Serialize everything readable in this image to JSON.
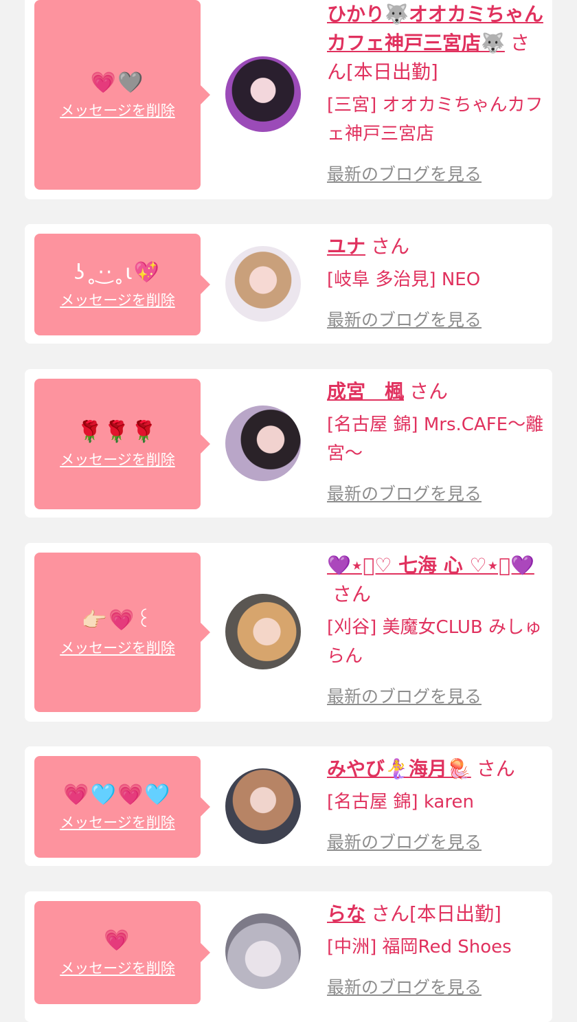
{
  "items": [
    {
      "emoji": "💗🩶",
      "delete_label": "メッセージを削除",
      "name": "ひかり🐺オオカミちゃんカフェ神戸三宮店🐺",
      "suffix": "さん[本日出勤]",
      "shop": "[三宮] オオカミちゃんカフェ神戸三宮店",
      "blog_label": "最新のブログを見る"
    },
    {
      "emoji": "ʖ˳·͜·˳ɩ💖",
      "delete_label": "メッセージを削除",
      "name": "ユナ",
      "suffix": "さん",
      "shop": "[岐阜 多治見] NEO",
      "blog_label": "最新のブログを見る"
    },
    {
      "emoji": "🌹🌹🌹",
      "delete_label": "メッセージを削除",
      "name": "成宮　楓",
      "suffix": "さん",
      "shop": "[名古屋 錦] Mrs.CAFE〜離宮〜",
      "blog_label": "最新のブログを見る"
    },
    {
      "emoji": "👉🏻💗꒰",
      "delete_label": "メッセージを削除",
      "name": "💜⋆͛♡ 七海 心 ♡⋆͛💜",
      "suffix": "さん",
      "shop": "[刈谷] 美魔女CLUB みしゅらん",
      "blog_label": "最新のブログを見る"
    },
    {
      "emoji": "💗🩵💗🩵",
      "delete_label": "メッセージを削除",
      "name": "みやび🧜‍♀️海月🪼",
      "suffix": "さん",
      "shop": "[名古屋 錦] karen",
      "blog_label": "最新のブログを見る"
    },
    {
      "emoji": "💗",
      "delete_label": "メッセージを削除",
      "name": "らな",
      "suffix": "さん[本日出勤]",
      "shop": "[中洲] 福岡Red Shoes",
      "blog_label": "最新のブログを見る"
    }
  ]
}
